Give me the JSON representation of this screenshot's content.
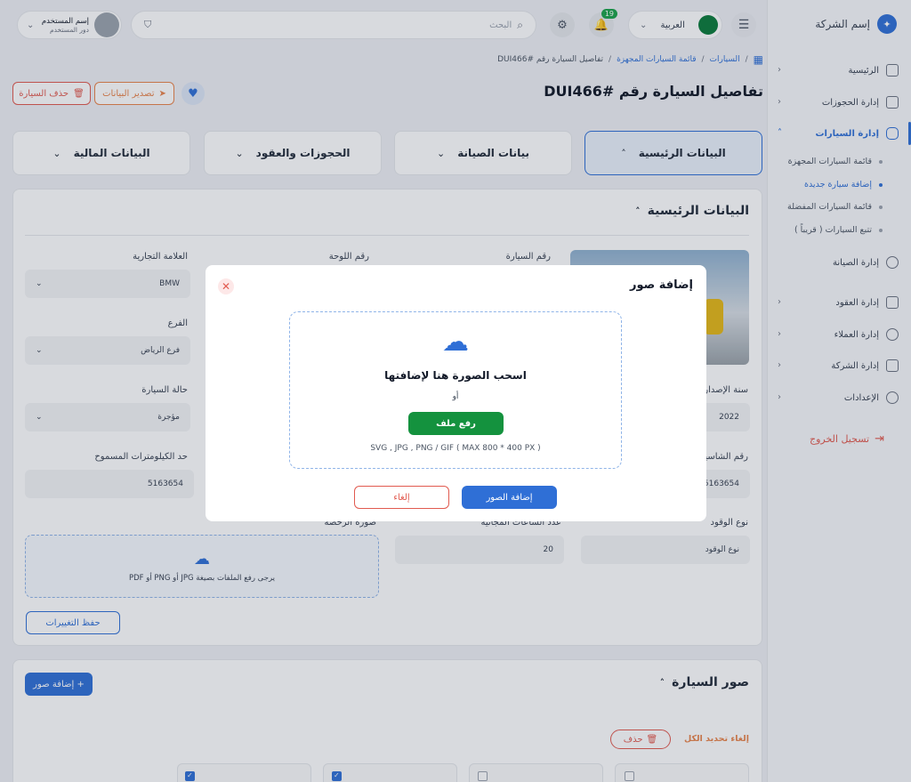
{
  "sidebar": {
    "company_name": "إسم الشركة",
    "items": [
      {
        "label": "الرئيسية",
        "icon": "grid-icon"
      },
      {
        "label": "إدارة الحجوزات",
        "icon": "clipboard-icon"
      },
      {
        "label": "إدارة السيارات",
        "icon": "car-icon"
      },
      {
        "label": "إدارة الصيانة",
        "icon": "wrench-icon"
      },
      {
        "label": "إدارة العقود",
        "icon": "contract-icon"
      },
      {
        "label": "إدارة العملاء",
        "icon": "users-icon"
      },
      {
        "label": "إدارة الشركة",
        "icon": "building-icon"
      },
      {
        "label": "الإعدادات",
        "icon": "gear-icon"
      }
    ],
    "sub_items": [
      "قائمة السيارات المجهزة",
      "إضافة سيارة جديدة",
      "قائمة السيارات المفضلة",
      "تتبع السيارات ( قريباً )"
    ],
    "logout": "تسجيل الخروج"
  },
  "topbar": {
    "language": "العربية",
    "notification_count": "19",
    "search_placeholder": "البحث",
    "user_name": "إسم المستخدم",
    "user_role": "دور المستخدم"
  },
  "breadcrumb": [
    "السيارات",
    "قائمة السيارات المجهزة",
    "تفاصيل السيارة رقم #DUI466"
  ],
  "page": {
    "title": "تفاصيل السيارة رقم #DUI466",
    "export_label": "تصدير البيانات",
    "delete_label": "حذف السيارة"
  },
  "tabs": [
    "البيانات الرئيسية",
    "بيانات الصيانة",
    "الحجوزات والعقود",
    "البيانات المالية"
  ],
  "main_section": {
    "title": "البيانات الرئيسية",
    "fields": {
      "car_number": {
        "label": "رقم السيارة"
      },
      "plate_number": {
        "label": "رقم اللوحة"
      },
      "brand": {
        "label": "العلامة التجارية",
        "value": "BMW"
      },
      "branch": {
        "label": "الفرع",
        "value": "فرع الرياض"
      },
      "year": {
        "label": "سنة الإصدار",
        "value": "2022"
      },
      "status": {
        "label": "حالة السيارة",
        "value": "مؤجرة"
      },
      "chassis": {
        "label": "رقم الشاسيه",
        "value": "5163654"
      },
      "km_limit": {
        "label": "حد الكيلومترات المسموح",
        "value": "5163654"
      },
      "fuel": {
        "label": "نوع الوقود",
        "value": "نوع الوقود"
      },
      "free_hours": {
        "label": "عدد الساعات المجانية",
        "value": "20"
      },
      "license": {
        "label": "صورة الرخصة",
        "upload_hint": "يرجى رفع الملفات بصيغة JPG أو PNG أو PDF"
      }
    },
    "save_label": "حفظ التغييرات"
  },
  "photos_section": {
    "title": "صور السيارة",
    "add_label": "+ إضافة صور",
    "deselect_label": "إلغاء تحديد الكل",
    "delete_label": "حذف"
  },
  "modal": {
    "title": "إضافة صور",
    "drop_title": "اسحب الصورة هنا لإضافتها",
    "or": "أو",
    "upload_label": "رفع ملف",
    "formats": "SVG , JPG , PNG / GIF ( MAX 800 * 400 PX )",
    "confirm_label": "إضافة الصور",
    "cancel_label": "إلغاء"
  },
  "colors": {
    "primary": "#2f6fd6",
    "success": "#14923e",
    "danger": "#e15a4f",
    "orange": "#e8834a"
  }
}
